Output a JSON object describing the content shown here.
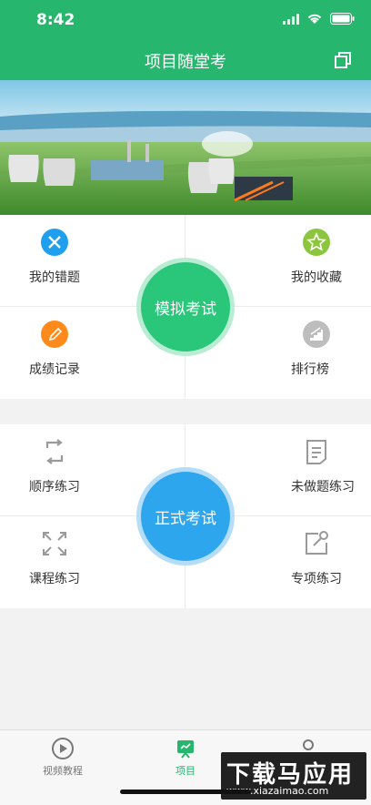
{
  "status": {
    "time": "8:42"
  },
  "header": {
    "title": "项目随堂考"
  },
  "section1": {
    "items": [
      {
        "label": "我的错题"
      },
      {
        "label": "我的收藏"
      },
      {
        "label": "成绩记录"
      },
      {
        "label": "排行榜"
      }
    ],
    "center_button": "模拟考试"
  },
  "section2": {
    "items": [
      {
        "label": "顺序练习"
      },
      {
        "label": "未做题练习"
      },
      {
        "label": "课程练习"
      },
      {
        "label": "专项练习"
      }
    ],
    "center_button": "正式考试"
  },
  "tabbar": {
    "tabs": [
      {
        "label": "视频教程"
      },
      {
        "label": "项目"
      }
    ]
  },
  "watermark": {
    "main": "下载马应用",
    "url": "www.xiazaimao.com"
  },
  "colors": {
    "brand": "#27b66e",
    "blue": "#2ea6ee"
  }
}
